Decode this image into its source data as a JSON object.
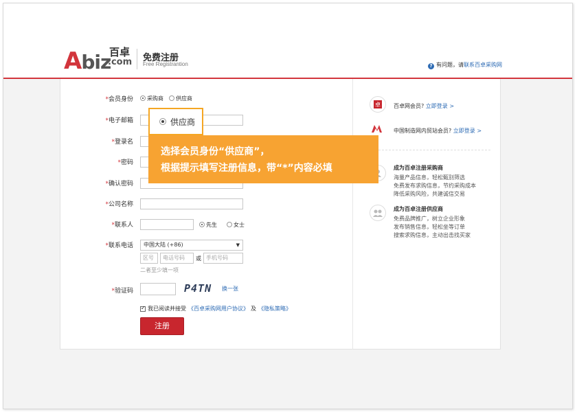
{
  "header": {
    "logo_letters": "biz",
    "logo_A": "A",
    "logo_cn": "百卓",
    "logo_com": ".com",
    "title": "免费注册",
    "subtitle": "Free Registrantion",
    "help_prefix": "有问题，请",
    "help_link": "联系百卓采购网"
  },
  "form": {
    "member_type_label": "会员身份",
    "member_type_options": [
      "采购商",
      "供应商"
    ],
    "email_label": "电子邮箱",
    "login_label": "登录名",
    "password_label": "密码",
    "confirm_password_label": "确认密码",
    "company_label": "公司名称",
    "contact_label": "联系人",
    "gender_options": [
      "先生",
      "女士"
    ],
    "phone_label": "联系电话",
    "country_select": "中国大陆 (+86)",
    "area_code_placeholder": "区号",
    "phone_placeholder": "电话号码",
    "or_text": "或",
    "mobile_placeholder": "手机号码",
    "phone_hint": "二者至少填一项",
    "captcha_label": "验证码",
    "captcha_text": "P4TN",
    "captcha_refresh": "换一张",
    "agree_prefix": "我已阅读并接受",
    "agree_link1": "《百卓采购网用户协议》",
    "agree_mid": "及",
    "agree_link2": "《隐私策略》",
    "submit_label": "注册",
    "required_mark": "*"
  },
  "sidebar": {
    "member_login_text": "百卓网会员?",
    "member_login_link": "立即登录 >",
    "mic_login_text": "中国制造网内贸站会员?",
    "mic_login_link": "立即登录 >",
    "buyer_title": "成为百卓注册采购商",
    "buyer_lines": [
      "海量产品信息，轻松甄别筛选",
      "免费发布求购信息，节约采购成本",
      "降低采购风险，共建诚信交易"
    ],
    "supplier_title": "成为百卓注册供应商",
    "supplier_lines": [
      "免费品牌推广，树立企业形象",
      "发布销售信息，轻松坐等订单",
      "搜索求购信息，主动出击找买家"
    ]
  },
  "callout": {
    "small_label": "供应商",
    "line1": "选择会员身份“供应商”，",
    "line2": "根据提示填写注册信息，带“*”内容必填"
  },
  "colors": {
    "brand_red": "#c8262e",
    "callout_orange": "#f7a332",
    "link_blue": "#2d6bb4"
  }
}
